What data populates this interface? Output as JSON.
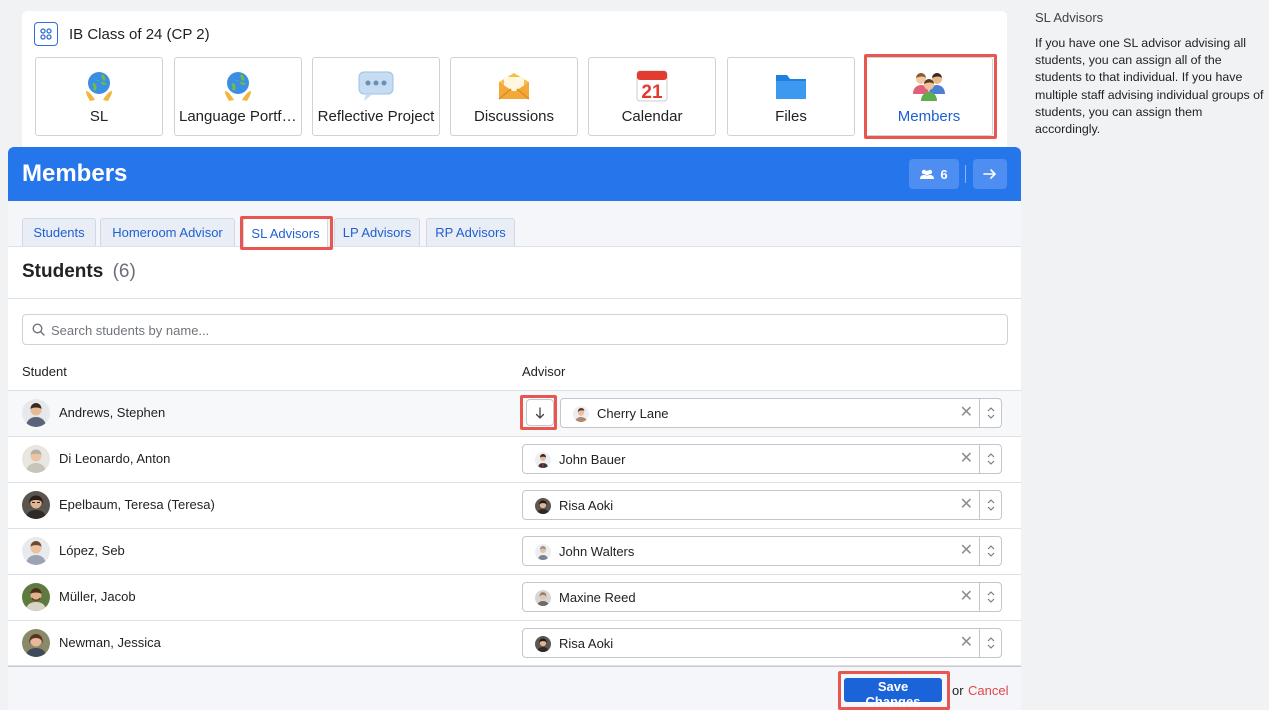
{
  "class": {
    "title": "IB Class of 24 (CP 2)"
  },
  "tiles": [
    {
      "label": "SL",
      "icon": "globe-hands-icon"
    },
    {
      "label": "Language Portfolio",
      "icon": "globe-hands-icon"
    },
    {
      "label": "Reflective Project",
      "icon": "speech-bubble-icon"
    },
    {
      "label": "Discussions",
      "icon": "envelope-icon"
    },
    {
      "label": "Calendar",
      "icon": "calendar-icon",
      "day": "21"
    },
    {
      "label": "Files",
      "icon": "folder-icon"
    },
    {
      "label": "Members",
      "icon": "people-icon",
      "active": true
    }
  ],
  "panel": {
    "title": "Members",
    "member_count": "6",
    "tabs": [
      {
        "label": "Students"
      },
      {
        "label": "Homeroom Advisor"
      },
      {
        "label": "SL Advisors",
        "active": true
      },
      {
        "label": "LP Advisors"
      },
      {
        "label": "RP Advisors"
      }
    ],
    "heading": "Students",
    "heading_count": "(6)",
    "search_placeholder": "Search students by name...",
    "columns": {
      "student": "Student",
      "advisor": "Advisor"
    },
    "rows": [
      {
        "student": "Andrews, Stephen",
        "advisor": "Cherry Lane"
      },
      {
        "student": "Di Leonardo, Anton",
        "advisor": "John Bauer"
      },
      {
        "student": "Epelbaum, Teresa (Teresa)",
        "advisor": "Risa Aoki"
      },
      {
        "student": "López, Seb",
        "advisor": "John Walters"
      },
      {
        "student": "Müller, Jacob",
        "advisor": "Maxine Reed"
      },
      {
        "student": "Newman, Jessica",
        "advisor": "Risa Aoki"
      }
    ],
    "save_label": "Save Changes",
    "or_label": "or",
    "cancel_label": "Cancel"
  },
  "sidebar": {
    "title": "SL Advisors",
    "text": "If you have one SL advisor advising all students, you can assign all of the students to that individual. If you have multiple staff advising individual groups of students, you can assign them accordingly."
  },
  "colors": {
    "primary": "#2576eb",
    "button": "#1a63d8",
    "highlight": "#e8574f",
    "cancel": "#e04848"
  }
}
